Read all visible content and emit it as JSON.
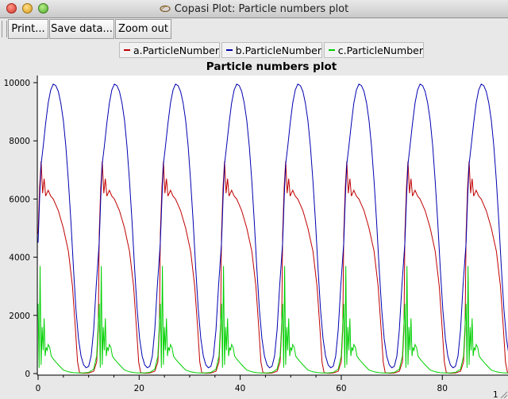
{
  "window": {
    "title": "Copasi Plot: Particle numbers plot"
  },
  "toolbar": {
    "print_label": "Print...",
    "save_label": "Save data...",
    "zoom_label": "Zoom out"
  },
  "legend": [
    {
      "label": "a.ParticleNumber",
      "color": "#c00000"
    },
    {
      "label": "b.ParticleNumber",
      "color": "#0000b0"
    },
    {
      "label": "c.ParticleNumber",
      "color": "#00d000"
    }
  ],
  "chart_data": {
    "type": "line",
    "title": "Particle numbers plot",
    "xlim": [
      0,
      100
    ],
    "ylim": [
      0,
      10000
    ],
    "xticks": [
      0,
      20,
      40,
      60,
      80
    ],
    "yticks": [
      0,
      2000,
      4000,
      6000,
      8000,
      10000
    ],
    "x_edge_label": "1",
    "grid": false,
    "legend_position": "top",
    "period": 12.1,
    "series": [
      {
        "name": "a.ParticleNumber",
        "color": "#c00000",
        "x": [
          0,
          0.3,
          0.6,
          0.9,
          1.2,
          1.5,
          2,
          2.5,
          3,
          3.5,
          4,
          5,
          6,
          6.8,
          7.4,
          7.8,
          8.2,
          9,
          10,
          11,
          11.6,
          11.9,
          12.1
        ],
        "values": [
          4800,
          6400,
          7300,
          6200,
          6700,
          6100,
          6300,
          6100,
          6000,
          5800,
          5600,
          5000,
          4200,
          3000,
          1500,
          400,
          30,
          10,
          20,
          80,
          400,
          1500,
          4800
        ]
      },
      {
        "name": "b.ParticleNumber",
        "color": "#0000b0",
        "x": [
          0,
          0.3,
          0.6,
          1,
          1.5,
          2,
          2.5,
          3,
          3.5,
          4,
          4.5,
          5,
          5.5,
          6,
          6.5,
          7,
          7.5,
          8,
          8.5,
          9,
          9.5,
          10,
          10.5,
          11,
          11.5,
          12.1
        ],
        "values": [
          4500,
          6000,
          7200,
          7800,
          8600,
          9300,
          9750,
          9950,
          9900,
          9700,
          9300,
          8700,
          7800,
          6600,
          5200,
          3600,
          2200,
          1200,
          600,
          300,
          200,
          250,
          600,
          1500,
          3000,
          4500
        ]
      },
      {
        "name": "c.ParticleNumber",
        "color": "#00d000",
        "x": [
          0,
          0.2,
          0.4,
          0.6,
          0.8,
          1,
          1.2,
          1.4,
          1.6,
          1.8,
          2,
          2.3,
          2.6,
          3,
          3.5,
          4,
          5,
          6,
          7,
          8,
          9,
          10,
          11,
          11.6,
          12.1
        ],
        "values": [
          2400,
          200,
          3700,
          300,
          1600,
          800,
          1900,
          600,
          900,
          800,
          1000,
          900,
          600,
          500,
          400,
          300,
          120,
          60,
          30,
          20,
          20,
          40,
          150,
          600,
          2400
        ]
      }
    ]
  }
}
